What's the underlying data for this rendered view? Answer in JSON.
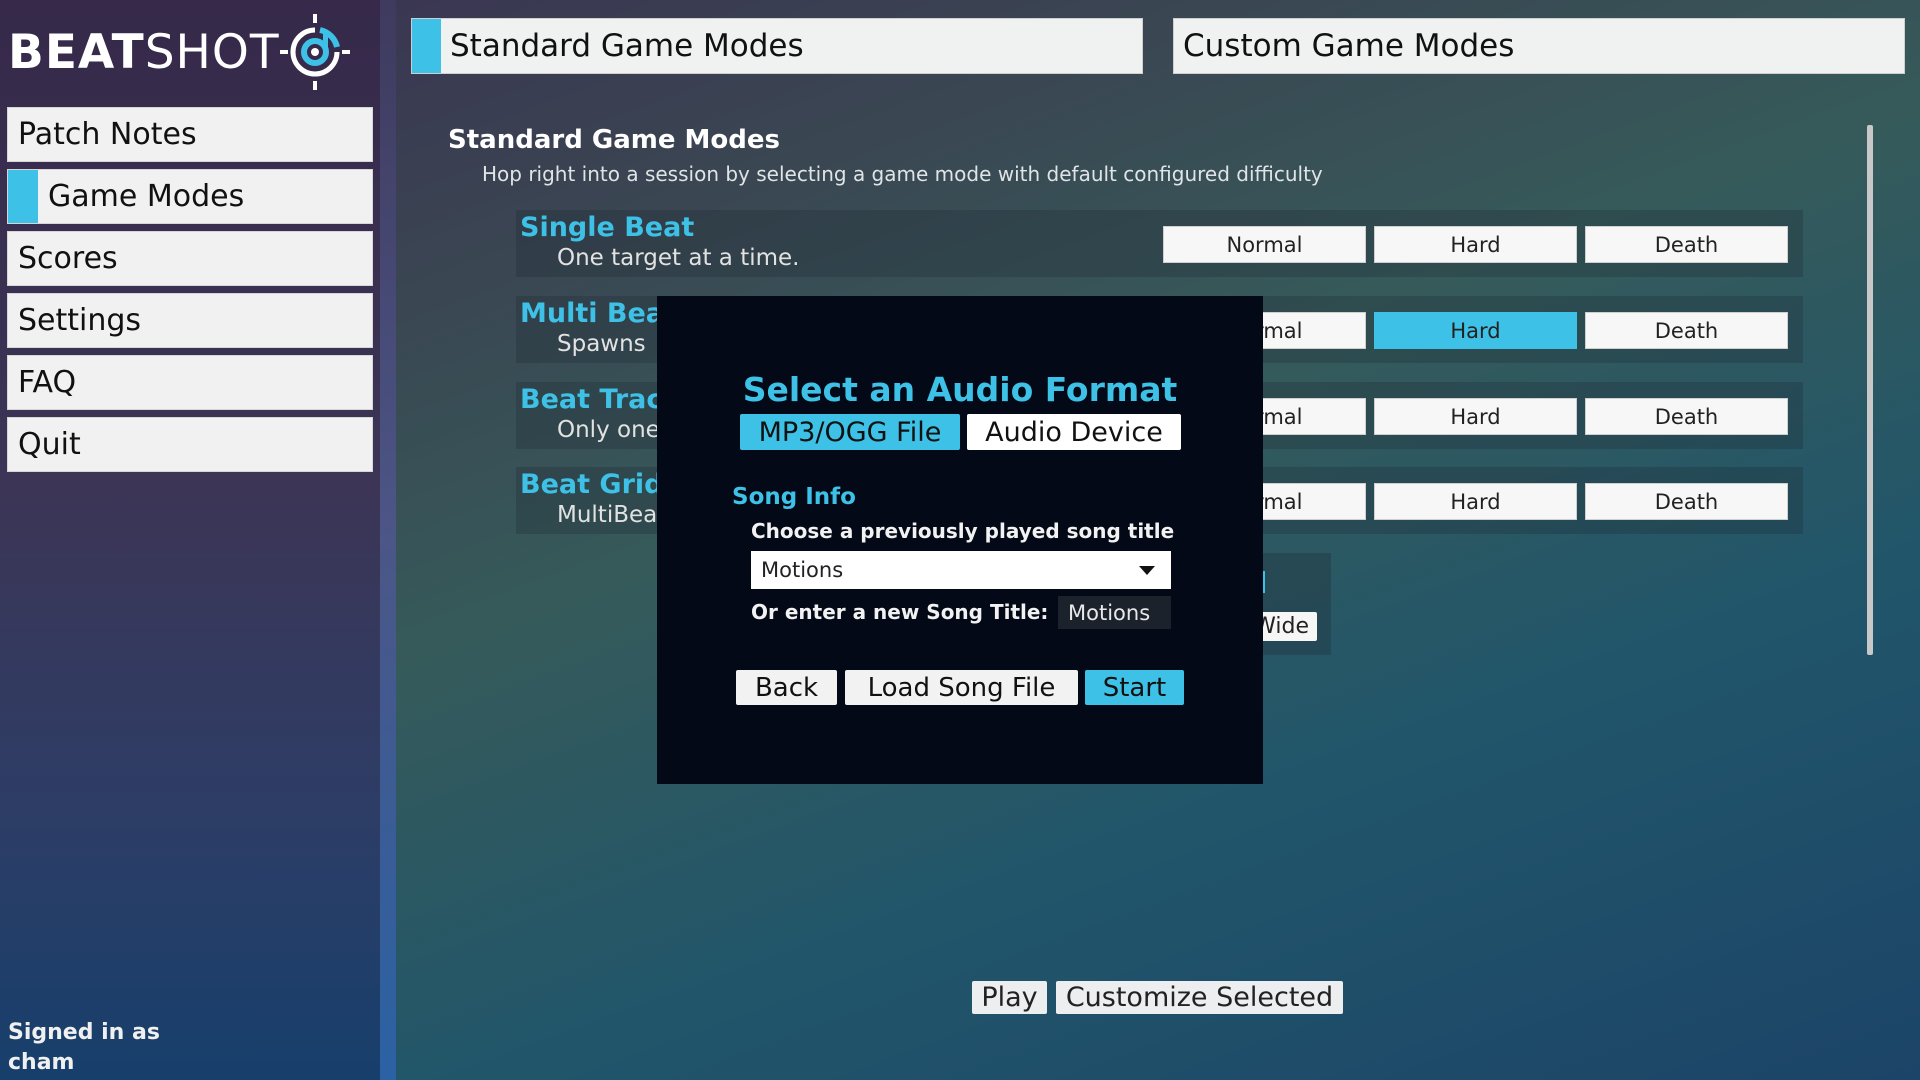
{
  "app": {
    "logo_bold": "BEAT",
    "logo_light": "SHOT",
    "logo_icon": "target-music-note-icon",
    "accent_color": "#3ec1e6"
  },
  "sidebar": {
    "items": [
      {
        "label": "Patch Notes",
        "active": false
      },
      {
        "label": "Game Modes",
        "active": true
      },
      {
        "label": "Scores",
        "active": false
      },
      {
        "label": "Settings",
        "active": false
      },
      {
        "label": "FAQ",
        "active": false
      },
      {
        "label": "Quit",
        "active": false
      }
    ],
    "signed_in_label": "Signed in as",
    "username": "cham"
  },
  "tabs": [
    {
      "label": "Standard Game Modes",
      "active": true
    },
    {
      "label": "Custom Game Modes",
      "active": false
    }
  ],
  "main": {
    "section_title": "Standard Game Modes",
    "section_subtitle": "Hop right into a session by selecting a game mode with default configured difficulty",
    "modes": [
      {
        "name": "Single Beat",
        "description": "One target at a time.",
        "difficulties": [
          "Normal",
          "Hard",
          "Death"
        ],
        "selected": null
      },
      {
        "name": "Multi Beat",
        "description": "Spawns",
        "difficulties": [
          "Normal",
          "Hard",
          "Death"
        ],
        "selected": "Hard"
      },
      {
        "name": "Beat Track",
        "description": "Only one",
        "difficulties": [
          "Normal",
          "Hard",
          "Death"
        ],
        "selected": null
      },
      {
        "name": "Beat Grid",
        "description": "MultiBea",
        "difficulties": [
          "Normal",
          "Hard",
          "Death"
        ],
        "selected": null
      }
    ],
    "partial_card_button": "Wide",
    "play_label": "Play",
    "customize_label": "Customize Selected"
  },
  "modal": {
    "title": "Select an Audio Format",
    "formats": [
      {
        "label": "MP3/OGG File",
        "selected": true
      },
      {
        "label": "Audio Device",
        "selected": false
      }
    ],
    "song_info_heading": "Song Info",
    "choose_label": "Choose a previously played song title",
    "selected_song": "Motions",
    "new_title_label": "Or enter a new Song Title:",
    "new_title_value": "Motions",
    "back_label": "Back",
    "load_label": "Load Song File",
    "start_label": "Start"
  }
}
